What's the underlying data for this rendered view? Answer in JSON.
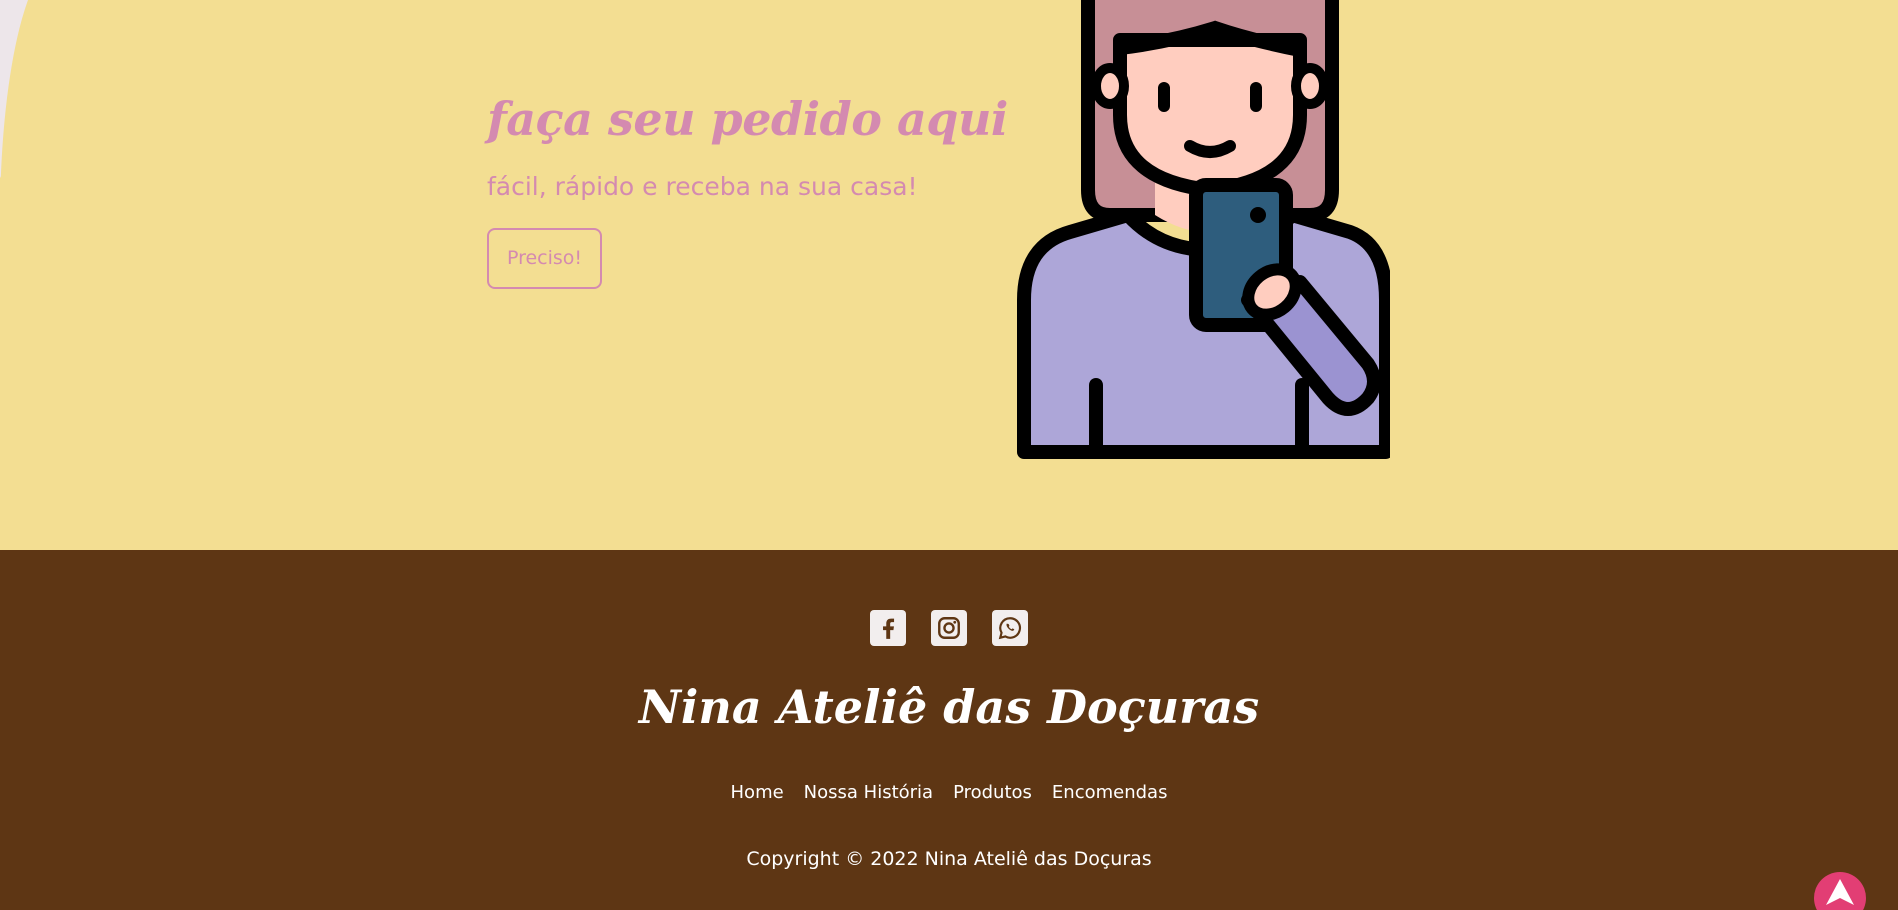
{
  "hero": {
    "title": "faça seu pedido aqui",
    "subtitle": "fácil, rápido e receba na sua casa!",
    "cta_label": "Preciso!",
    "illustration_icon": "woman-with-phone-icon"
  },
  "footer": {
    "socials": [
      {
        "name": "facebook",
        "icon": "facebook-icon"
      },
      {
        "name": "instagram",
        "icon": "instagram-icon"
      },
      {
        "name": "whatsapp",
        "icon": "whatsapp-icon"
      }
    ],
    "brand": "Nina Ateliê das Doçuras",
    "nav": [
      "Home",
      "Nossa História",
      "Produtos",
      "Encomendas"
    ],
    "copyright": "Copyright © 2022 Nina Ateliê das Doçuras"
  },
  "back_to_top_icon": "arrow-up-icon",
  "colors": {
    "hero_bg": "#f3de92",
    "accent_pink": "#d48ab0",
    "footer_bg": "#5e3614",
    "back_to_top": "#e23e74"
  }
}
